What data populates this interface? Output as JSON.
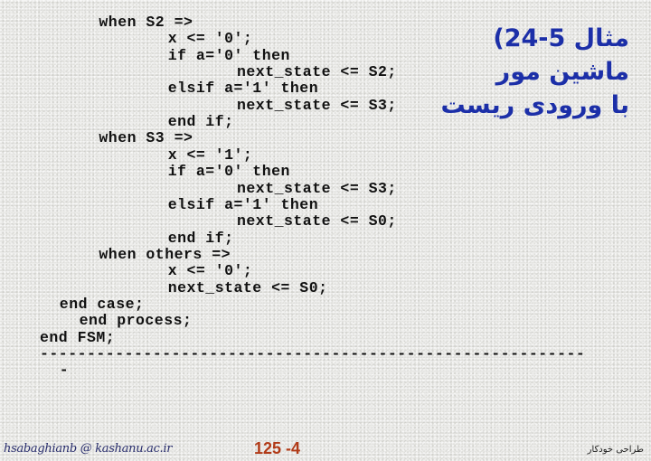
{
  "slide": {
    "title": {
      "lines": [
        "مثال 5-24)",
        "ماشین مور",
        "با ورودی ریست"
      ]
    },
    "code": {
      "lines": [
        {
          "indent": 6,
          "text": "when S2 =>"
        },
        {
          "indent": 13,
          "text": "x <= '0';"
        },
        {
          "indent": 13,
          "text": "if a='0' then"
        },
        {
          "indent": 20,
          "text": "next_state <= S2;"
        },
        {
          "indent": 13,
          "text": "elsif a='1' then"
        },
        {
          "indent": 20,
          "text": "next_state <= S3;"
        },
        {
          "indent": 13,
          "text": "end if;"
        },
        {
          "indent": 6,
          "text": "when S3 =>"
        },
        {
          "indent": 13,
          "text": "x <= '1';"
        },
        {
          "indent": 13,
          "text": "if a='0' then"
        },
        {
          "indent": 20,
          "text": "next_state <= S3;"
        },
        {
          "indent": 13,
          "text": "elsif a='1' then"
        },
        {
          "indent": 20,
          "text": "next_state <= S0;"
        },
        {
          "indent": 13,
          "text": "end if;"
        },
        {
          "indent": 6,
          "text": "when others =>"
        },
        {
          "indent": 13,
          "text": "x <= '0';"
        },
        {
          "indent": 13,
          "text": "next_state <= S0;"
        },
        {
          "indent": 2,
          "text": "end case;"
        },
        {
          "indent": 4,
          "text": "end process;"
        },
        {
          "indent": 0,
          "text": "end FSM;"
        },
        {
          "indent": 0,
          "text": "----------------------------------------------------------"
        },
        {
          "indent": 2,
          "text": "-"
        }
      ]
    },
    "footer": {
      "email": "hsabaghianb @ kashanu.ac.ir",
      "page": "125 -4",
      "course": "طراحی خودکار"
    }
  },
  "colors": {
    "title": "#1c2fa8",
    "code": "#111111",
    "page_number": "#b13a17",
    "email": "#2a2f6e",
    "background": "#ececea"
  }
}
